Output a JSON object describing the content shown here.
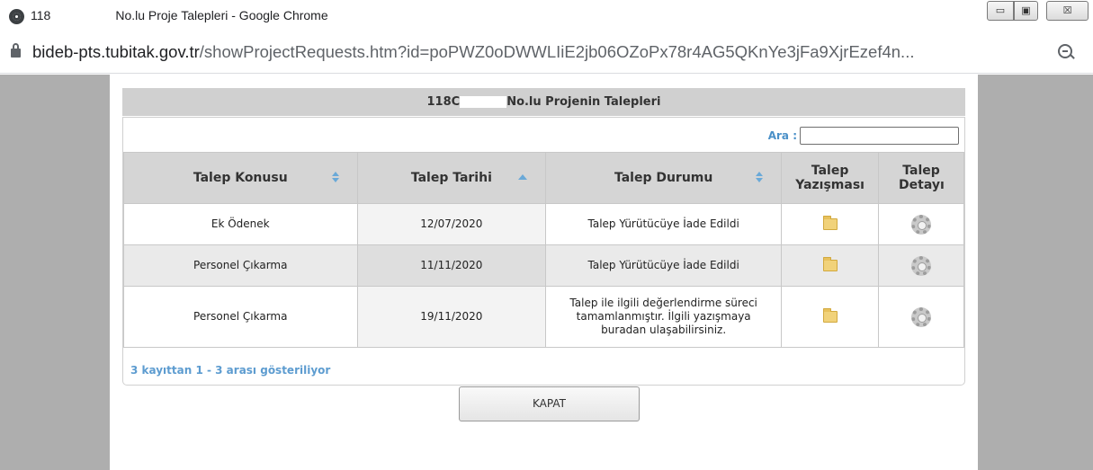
{
  "window": {
    "title_prefix": "118",
    "title_suffix": "No.lu Proje Talepleri - Google Chrome",
    "minimize_label": "▭",
    "maximize_label": "▣",
    "close_label": "☒"
  },
  "address_bar": {
    "host": "bideb-pts.tubitak.gov.tr",
    "path": "/showProjectRequests.htm?id=poPWZ0oDWWLIiE2jb06OZoPx78r4AG5QKnYe3jFa9XjrEzef4n..."
  },
  "dialog": {
    "header_prefix": "118C",
    "header_suffix": "No.lu Projenin Talepleri",
    "search_label": "Ara :",
    "search_value": "",
    "columns": [
      "Talep Konusu",
      "Talep Tarihi",
      "Talep Durumu",
      "Talep Yazışması",
      "Talep Detayı"
    ],
    "rows": [
      {
        "subject": "Ek Ödenek",
        "date": "12/07/2020",
        "status": "Talep Yürütücüye İade Edildi"
      },
      {
        "subject": "Personel Çıkarma",
        "date": "11/11/2020",
        "status": "Talep Yürütücüye İade Edildi"
      },
      {
        "subject": "Personel Çıkarma",
        "date": "19/11/2020",
        "status": "Talep ile ilgili değerlendirme süreci tamamlanmıştır. İlgili yazışmaya buradan ulaşabilirsiniz."
      }
    ],
    "info": "3 kayıttan 1 - 3 arası gösteriliyor",
    "close_button": "KAPAT"
  }
}
